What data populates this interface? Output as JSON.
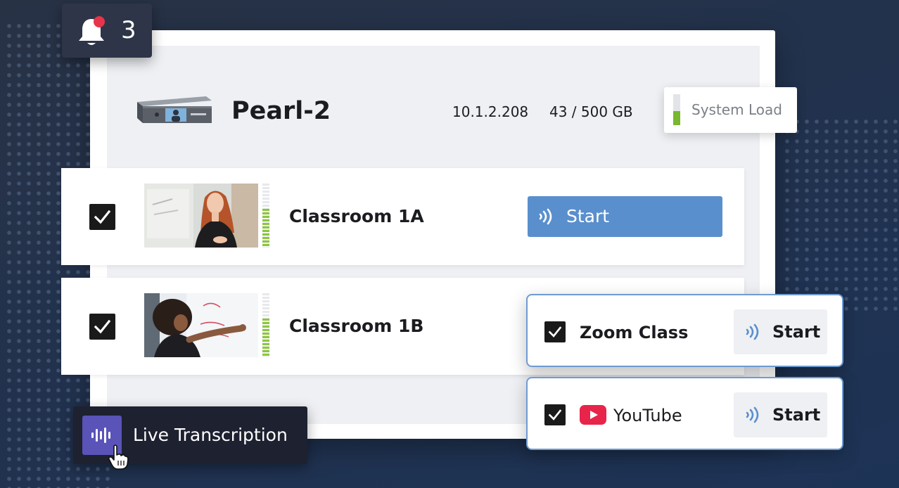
{
  "notification": {
    "count": "3",
    "icon": "bell-icon",
    "dot_color": "#e8344a"
  },
  "device": {
    "name": "Pearl-2",
    "ip": "10.1.2.208",
    "storage": "43 / 500 GB",
    "icon": "pearl-device-icon"
  },
  "system_load": {
    "label": "System Load",
    "level": 0.45,
    "color": "#78b72e"
  },
  "channels": [
    {
      "name": "Classroom 1A",
      "checked": true,
      "audio_level": 0.6,
      "start_label": "Start",
      "meter_color": "#8dc63f"
    },
    {
      "name": "Classroom 1B",
      "checked": true,
      "audio_level": 0.6,
      "start_label": "",
      "meter_color": "#8dc63f"
    }
  ],
  "destinations": [
    {
      "name": "Zoom Class",
      "checked": true,
      "start_label": "Start",
      "icon": ""
    },
    {
      "name": "YouTube",
      "checked": true,
      "start_label": "Start",
      "icon": "youtube-icon"
    }
  ],
  "live_transcription": {
    "label": "Live Transcription",
    "icon": "audio-waveform-icon",
    "color": "#5a53b8"
  },
  "colors": {
    "accent": "#5a8fcd",
    "card_border": "#6e9bd2",
    "youtube": "#e8244a"
  }
}
